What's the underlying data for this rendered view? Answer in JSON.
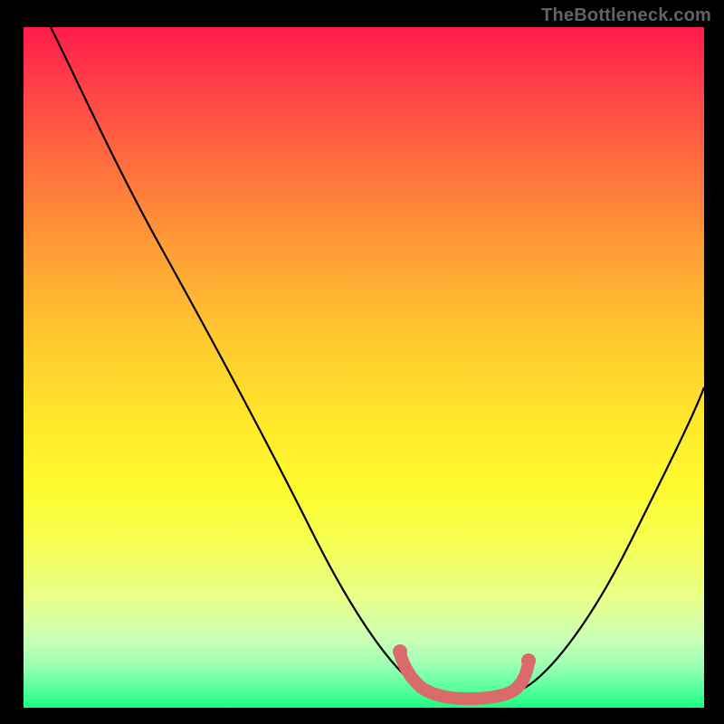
{
  "watermark": "TheBottleneck.com",
  "chart_data": {
    "type": "line",
    "title": "",
    "xlabel": "",
    "ylabel": "",
    "xlim": [
      0,
      100
    ],
    "ylim": [
      0,
      100
    ],
    "series": [
      {
        "name": "bottleneck-curve",
        "color": "#000000",
        "x": [
          4,
          10,
          18,
          26,
          34,
          42,
          50,
          54,
          58,
          62,
          66,
          70,
          74,
          80,
          86,
          92,
          100
        ],
        "y": [
          100,
          90,
          77,
          64,
          51,
          38,
          24,
          15,
          7,
          3,
          2,
          2,
          3,
          8,
          18,
          30,
          48
        ]
      }
    ],
    "annotations": [
      {
        "name": "flat-zone-marker",
        "type": "path",
        "color": "#e06666",
        "points_x": [
          56,
          58,
          60,
          62,
          64,
          66,
          68,
          70,
          72,
          73
        ],
        "points_y": [
          10,
          6,
          4,
          3,
          2.5,
          2.5,
          2.8,
          3.2,
          4.5,
          7
        ]
      }
    ],
    "gradient_stops": [
      {
        "pos": 0.0,
        "color": "#ff1b4b"
      },
      {
        "pos": 0.2,
        "color": "#ff6d3e"
      },
      {
        "pos": 0.45,
        "color": "#ffc62f"
      },
      {
        "pos": 0.68,
        "color": "#fdfb2f"
      },
      {
        "pos": 0.9,
        "color": "#c9ffb4"
      },
      {
        "pos": 1.0,
        "color": "#1aff80"
      }
    ]
  }
}
